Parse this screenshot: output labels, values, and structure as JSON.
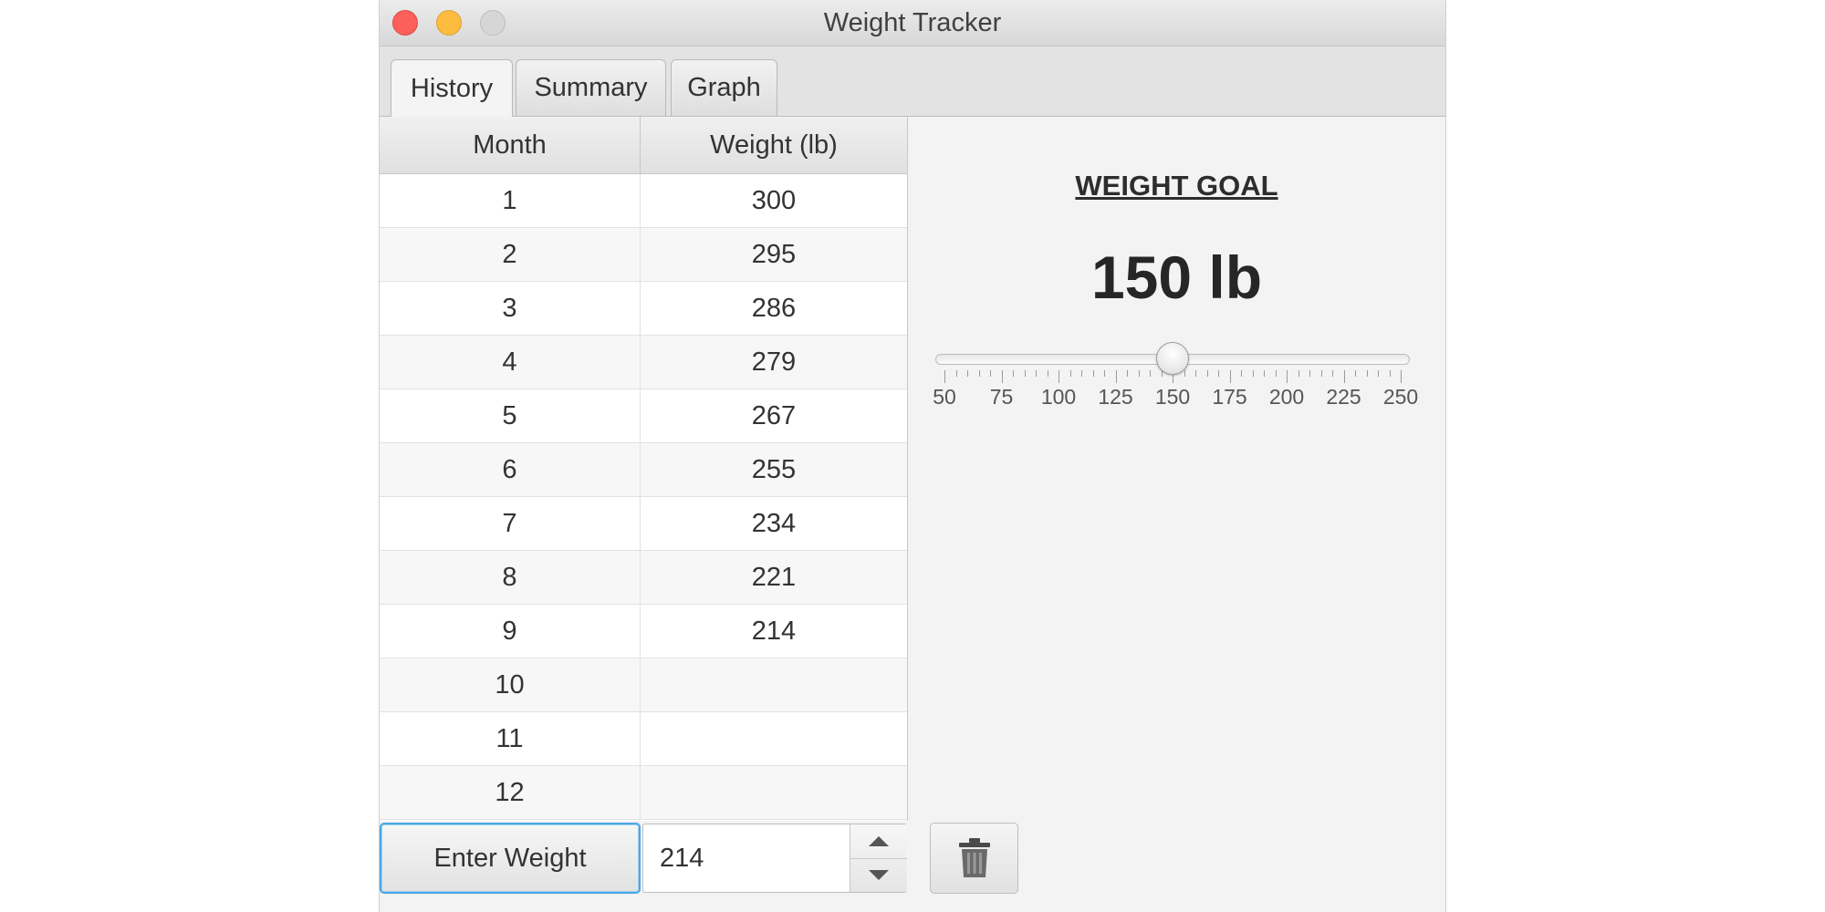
{
  "window": {
    "title": "Weight Tracker"
  },
  "tabs": [
    {
      "label": "History",
      "active": true
    },
    {
      "label": "Summary",
      "active": false
    },
    {
      "label": "Graph",
      "active": false
    }
  ],
  "table": {
    "columns": [
      "Month",
      "Weight (lb)"
    ],
    "rows": [
      {
        "month": "1",
        "weight": "300"
      },
      {
        "month": "2",
        "weight": "295"
      },
      {
        "month": "3",
        "weight": "286"
      },
      {
        "month": "4",
        "weight": "279"
      },
      {
        "month": "5",
        "weight": "267"
      },
      {
        "month": "6",
        "weight": "255"
      },
      {
        "month": "7",
        "weight": "234"
      },
      {
        "month": "8",
        "weight": "221"
      },
      {
        "month": "9",
        "weight": "214"
      },
      {
        "month": "10",
        "weight": ""
      },
      {
        "month": "11",
        "weight": ""
      },
      {
        "month": "12",
        "weight": ""
      }
    ]
  },
  "entry": {
    "button_label": "Enter Weight",
    "spinner_value": "214"
  },
  "icons": {
    "trash": "trash-icon",
    "spin_up": "chevron-up-icon",
    "spin_down": "chevron-down-icon"
  },
  "goal": {
    "heading": "WEIGHT GOAL",
    "value_text": "150 lb",
    "slider": {
      "min": 50,
      "max": 250,
      "value": 150,
      "major_tick_unit": 25,
      "minor_ticks_per_major": 4,
      "tick_labels": [
        "50",
        "75",
        "100",
        "125",
        "150",
        "175",
        "200",
        "225",
        "250"
      ]
    }
  },
  "colors": {
    "focus_accent": "#49a7e4",
    "close_light": "#fc605b",
    "minimize_light": "#fdbc40",
    "zoom_light": "#d6d6d6"
  }
}
